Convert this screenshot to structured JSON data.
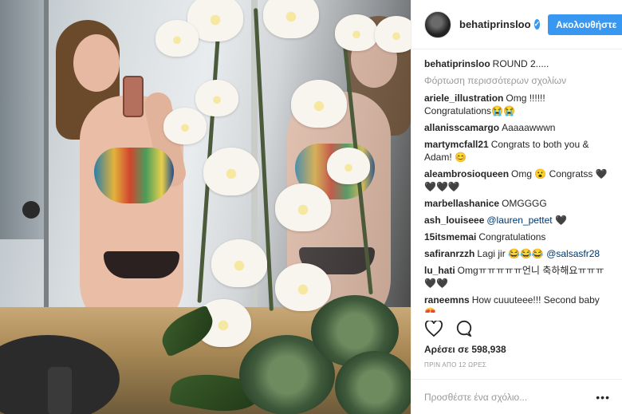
{
  "post": {
    "photo_alt": "Photo",
    "username": "behatiprinsloo",
    "follow_label": "Ακολουθήστε",
    "caption_user": "behatiprinsloo",
    "caption_text": "ROUND 2.....",
    "load_more": "Φόρτωση περισσότερων σχολίων",
    "likes": "Αρέσει σε 598,938",
    "time": "ΠΡΙΝ ΑΠΟ 12 ΩΡΕΣ",
    "comment_placeholder": "Προσθέστε ένα σχόλιο...",
    "more_label": "•••"
  },
  "comments": [
    {
      "user": "ariele_illustration",
      "text": "Omg !!!!!! Congratulations😭😭"
    },
    {
      "user": "allanisscamargo",
      "text": "Aaaaawwwn"
    },
    {
      "user": "martymcfall21",
      "text": "Congrats to both you & Adam! 😊"
    },
    {
      "user": "aleambrosioqueen",
      "text": "Omg 😮 Congratss 🖤🖤🖤🖤"
    },
    {
      "user": "marbellashanice",
      "text": "OMGGGG"
    },
    {
      "user": "ash_louiseee",
      "mention": "@lauren_pettet",
      "text": " 🖤"
    },
    {
      "user": "15itsmemai",
      "text": "Congratulations"
    },
    {
      "user": "safiranrzzh",
      "text": "Lagi jir 😂😂😂 ",
      "mention": "@salsasfr28"
    },
    {
      "user": "lu_hati",
      "text": "Omgㅠㅠㅠㅠㅠ언니 축하해요ㅠㅠㅠ🖤🖤"
    },
    {
      "user": "raneemns",
      "text": "How cuuuteee!!! Second baby😍"
    }
  ],
  "icons": {
    "heart": "heart-icon",
    "comment": "comment-bubble-icon",
    "verified": "verified-badge-icon",
    "more": "more-options-icon"
  },
  "colors": {
    "accent": "#3897f0",
    "mention": "#003569",
    "muted": "#999999"
  }
}
